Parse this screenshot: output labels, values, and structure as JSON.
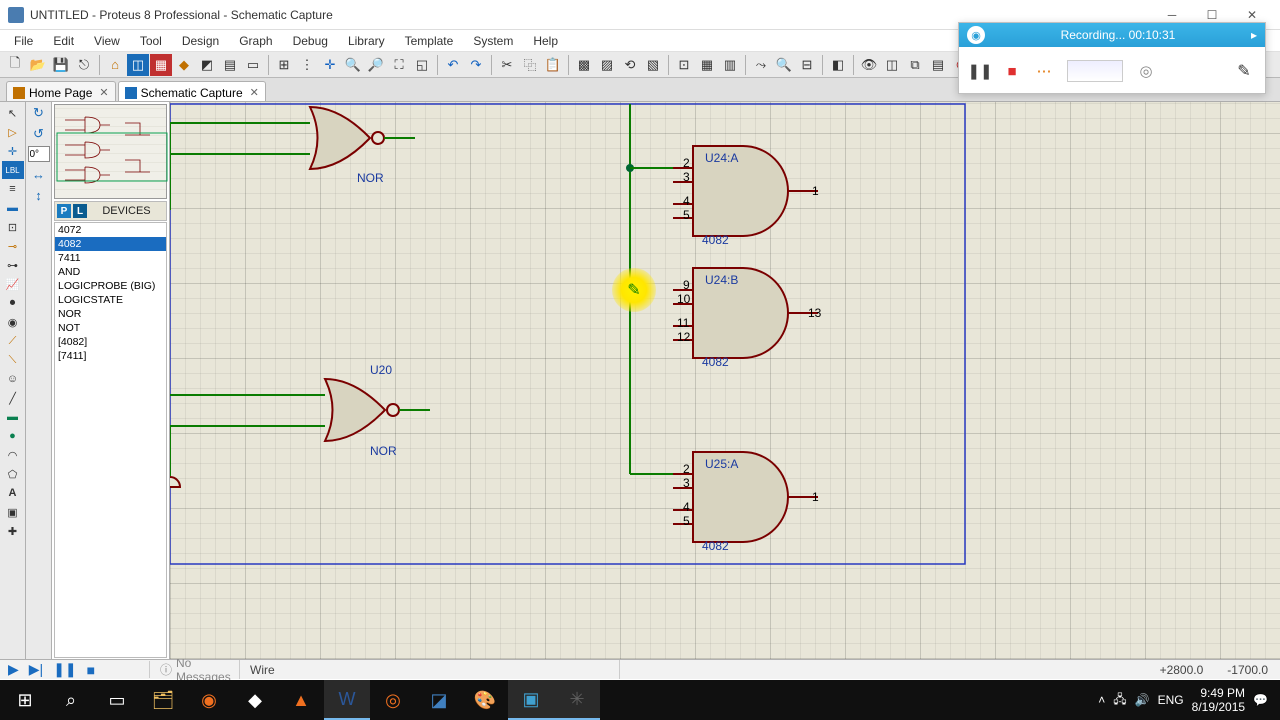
{
  "window": {
    "title": "UNTITLED - Proteus 8 Professional - Schematic Capture"
  },
  "menu": [
    "File",
    "Edit",
    "View",
    "Tool",
    "Design",
    "Graph",
    "Debug",
    "Library",
    "Template",
    "System",
    "Help"
  ],
  "tabs": [
    {
      "label": "Home Page",
      "active": false
    },
    {
      "label": "Schematic Capture",
      "active": true
    }
  ],
  "rotation_input": "0°",
  "devices": {
    "header": "DEVICES",
    "p_label": "P",
    "l_label": "L",
    "items": [
      "4072",
      "4082",
      "7411",
      "AND",
      "LOGICPROBE (BIG)",
      "LOGICSTATE",
      "NOR",
      "NOT",
      "[4082]",
      "[7411]"
    ],
    "selected": "4082"
  },
  "gates": {
    "nor_top": {
      "label": "NOR"
    },
    "u20": {
      "ref": "U20",
      "label": "NOR"
    },
    "u24a": {
      "ref": "U24:A",
      "part": "4082",
      "in": [
        "2",
        "3",
        "4",
        "5"
      ],
      "out": "1"
    },
    "u24b": {
      "ref": "U24:B",
      "part": "4082",
      "in": [
        "9",
        "10",
        "11",
        "12"
      ],
      "out": "13"
    },
    "u25a": {
      "ref": "U25:A",
      "part": "4082",
      "in": [
        "2",
        "3",
        "4",
        "5"
      ],
      "out": "1"
    }
  },
  "status": {
    "messages": "No Messages",
    "mode": "Wire",
    "coord_x": "+2800.0",
    "coord_y": "-1700.0"
  },
  "recorder": {
    "text": "Recording...",
    "time": "00:10:31"
  },
  "taskbar": {
    "lang": "ENG",
    "time": "9:49 PM",
    "date": "8/19/2015"
  }
}
